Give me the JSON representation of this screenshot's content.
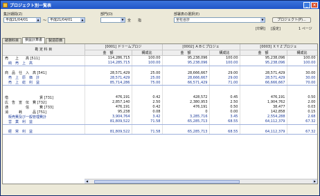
{
  "window": {
    "title": "プロジェクト別一覧表"
  },
  "filters": {
    "period_label": "集計期間(Z)",
    "period_from": "平成21/04/01",
    "period_sep": "～",
    "period_to": "平成21/04/01",
    "dept_label": "部門(D)",
    "dept_value": "",
    "dept_suffix": "全",
    "dept_btn": "指",
    "company_label": "部署表の選択(E)",
    "company_value": "全社合計",
    "project_btn": "プロジェクト(P)...",
    "print_btn": "[印刷]",
    "preview_btn": "[設定]",
    "page_label": "1 ページ"
  },
  "tabs": [
    "破損科目",
    "損益計算書",
    "製造原価"
  ],
  "table": {
    "headers": {
      "subject": "勘 定 科 目",
      "proj1": "[0001] ドリームプロジ",
      "proj2": "[0002] ＡＢＣプロジェ",
      "proj3": "[0003] ＸＹＺプロジェ",
      "amount": "金　額",
      "ratio": "構成比"
    },
    "rows": [
      {
        "label": "売　　上　　高 [511]",
        "v": [
          "114,286,715",
          "100.00",
          "95,238,096",
          "100.00",
          "95,238,096",
          "100.00"
        ],
        "style": ""
      },
      {
        "label": "　純　売　上　高",
        "v": [
          "114,285,715",
          "100.00",
          "95,238,096",
          "100.00",
          "95,238,096",
          "100.00"
        ],
        "style": "blueline"
      },
      {
        "label": "",
        "v": [
          "",
          "",
          "",
          "",
          "",
          ""
        ],
        "style": ""
      },
      {
        "label": "商　品　仕　入　高 [541]",
        "v": [
          "28,571,429",
          "25.00",
          "28,666,667",
          "29.00",
          "28,571,429",
          "30.00"
        ],
        "style": ""
      },
      {
        "label": "　売　上　原　価　計",
        "v": [
          "28,571,429",
          "25.00",
          "28,666,667",
          "29.00",
          "28,571,429",
          "30.00"
        ],
        "style": "blue"
      },
      {
        "label": "　売　上　総　利　益",
        "v": [
          "85,714,286",
          "75.00",
          "66,571,429",
          "71.00",
          "66,666,667",
          "70.00"
        ],
        "style": "blueline"
      },
      {
        "label": "",
        "v": [
          "",
          "",
          "",
          "",
          "",
          ""
        ],
        "style": ""
      },
      {
        "label": "",
        "v": [
          "",
          "",
          "",
          "",
          "",
          ""
        ],
        "style": ""
      },
      {
        "label": "借　　　　　　　　　賃 [731]",
        "v": [
          "476,191",
          "0.42",
          "428,572",
          "0.45",
          "476,191",
          "0.50"
        ],
        "style": ""
      },
      {
        "label": "広　告　宣　伝　費 [732]",
        "v": [
          "2,857,140",
          "2.50",
          "2,380,953",
          "2.50",
          "1,904,762",
          "2.00"
        ],
        "style": ""
      },
      {
        "label": "通　　　　　信　　　費 [733]",
        "v": [
          "476,191",
          "0.42",
          "476,191",
          "0.50",
          "38,477",
          "0.03"
        ],
        "style": ""
      },
      {
        "label": "消　　　耗　　　品 [751]",
        "v": [
          "95,238",
          "0.08",
          "0",
          "0.00",
          "142,858",
          "0.15"
        ],
        "style": ""
      },
      {
        "label": "　販売費及び一般管理費計",
        "v": [
          "3,904,764",
          "3.42",
          "3,285,716",
          "3.45",
          "2,554,288",
          "2.68"
        ],
        "style": "blue"
      },
      {
        "label": "　営　業　利　益",
        "v": [
          "81,809,522",
          "71.58",
          "65,285,713",
          "68.55",
          "64,112,379",
          "67.32"
        ],
        "style": "blueline"
      },
      {
        "label": "",
        "v": [
          "",
          "",
          "",
          "",
          "",
          ""
        ],
        "style": ""
      },
      {
        "label": "　経　常　利　益",
        "v": [
          "81,809,522",
          "71.58",
          "65,285,713",
          "68.55",
          "64,112,379",
          "67.32"
        ],
        "style": "blueline"
      }
    ]
  }
}
